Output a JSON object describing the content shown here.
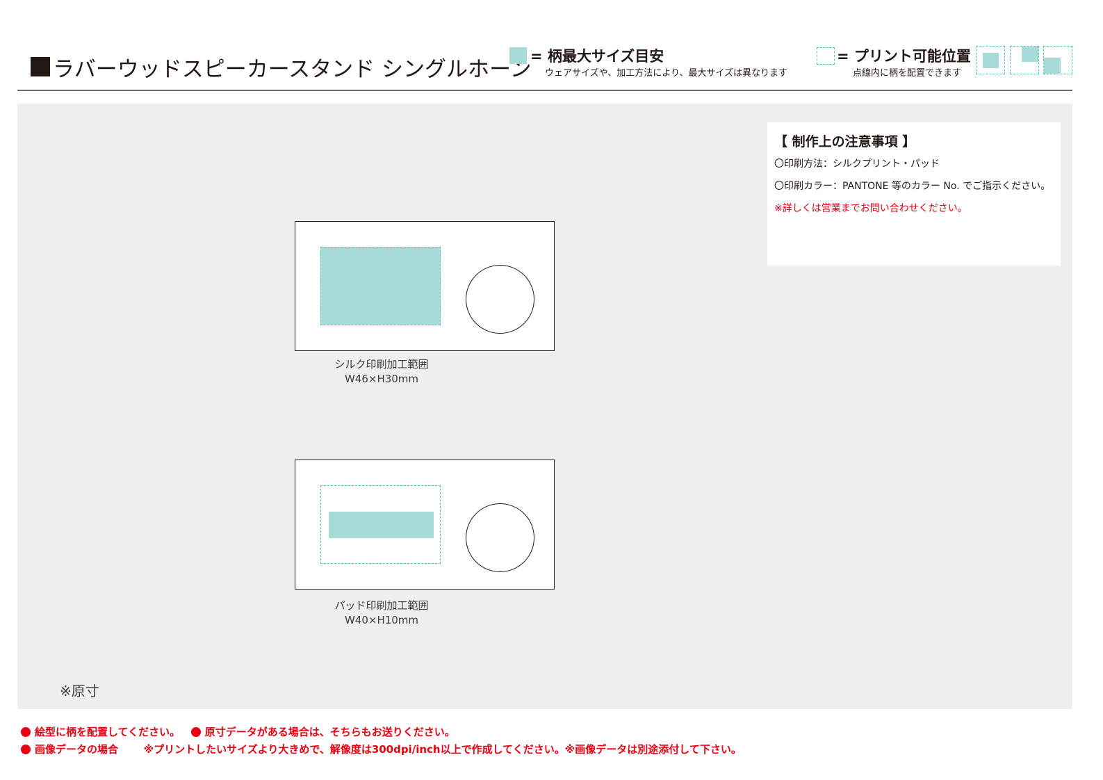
{
  "header": {
    "title": "ラバーウッドスピーカースタンド シングルホーン"
  },
  "legend": {
    "max_size": {
      "label": "= 柄最大サイズ目安",
      "sub": "ウェアサイズや、加工方法により、最大サイズは異なります"
    },
    "printable": {
      "label": "= プリント可能位置",
      "sub": "点線内に柄を配置できます"
    }
  },
  "notes": {
    "heading": "【 制作上の注意事項 】",
    "lines": [
      "〇印刷方法：シルクプリント・パッド",
      "〇印刷カラー：PANTONE 等のカラー No. でご指示ください。"
    ],
    "warning": "※詳しくは営業までお問い合わせください。"
  },
  "templates": [
    {
      "method": "シルク印刷加工範囲",
      "size": "W46×H30mm"
    },
    {
      "method": "パッド印刷加工範囲",
      "size": "W40×H10mm"
    }
  ],
  "scale_note": "※原寸",
  "footer": {
    "line1_a": "絵型に柄を配置してください。",
    "line1_b": "原寸データがある場合は、そちらもお送りください。",
    "line2_a": "画像データの場合",
    "line2_b": "※プリントしたいサイズより大きめで、解像度は300dpi/inch以上で作成してください。※画像データは別途添付して下さい。"
  },
  "colors": {
    "print_fill": "#a8dbd8",
    "dashed_border": "#5fc0c0",
    "canvas_bg": "#eeefee",
    "warning_red": "#e60012"
  }
}
